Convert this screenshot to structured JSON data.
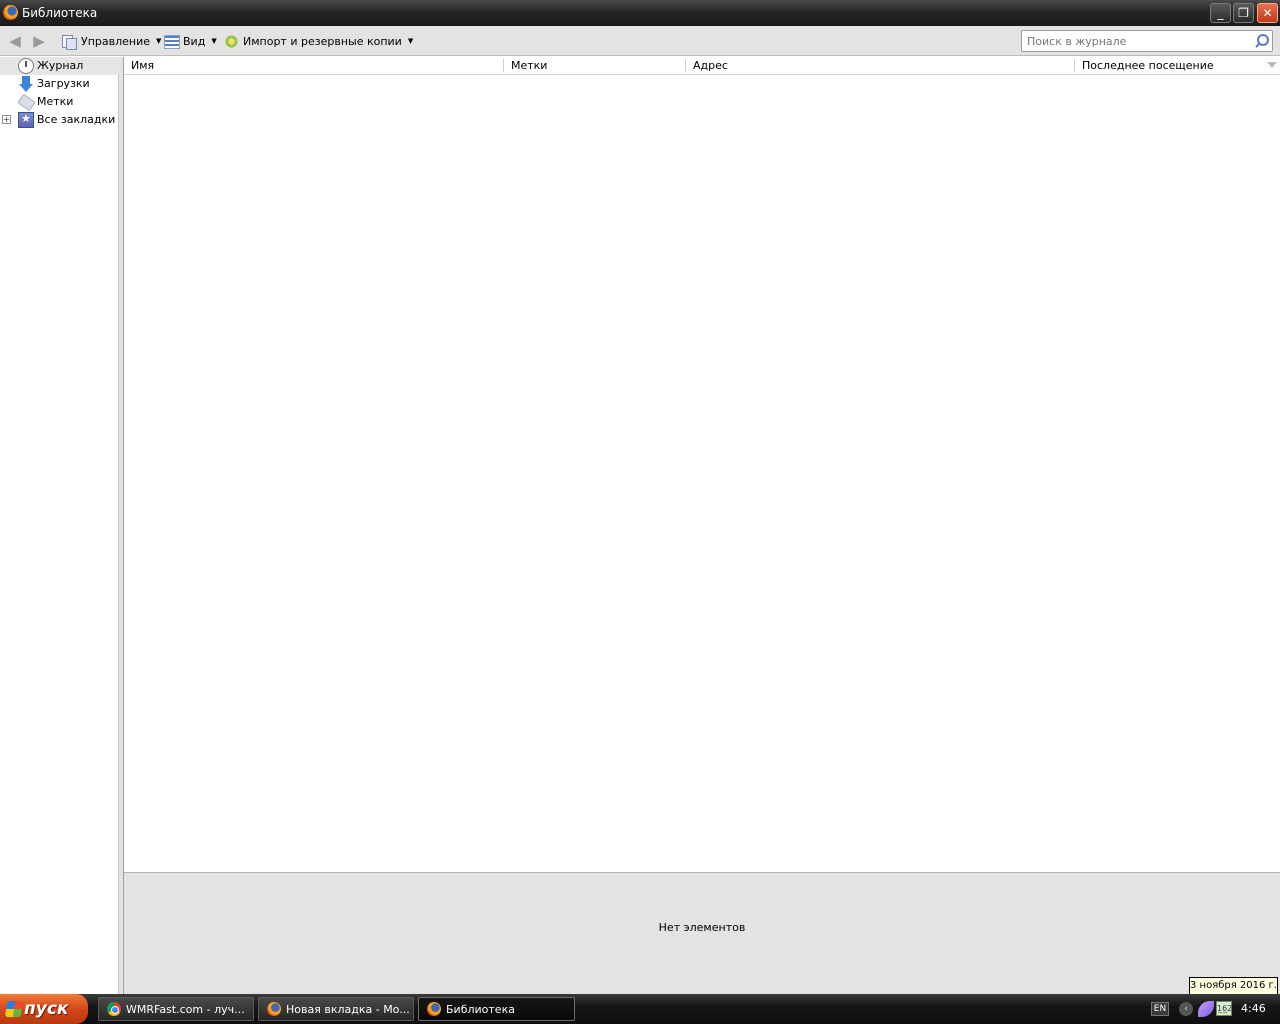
{
  "window": {
    "title": "Библиотека",
    "controls": {
      "minimize": "_",
      "restore": "❐",
      "close": "✕"
    }
  },
  "toolbar": {
    "back_icon": "back-arrow-icon",
    "forward_icon": "forward-arrow-icon",
    "organize_label": "Управление",
    "views_label": "Вид",
    "import_label": "Импорт и резервные копии",
    "search_placeholder": "Поиск в журнале"
  },
  "sidebar": {
    "items": [
      {
        "label": "Журнал",
        "icon": "clock-icon",
        "selected": true
      },
      {
        "label": "Загрузки",
        "icon": "download-icon"
      },
      {
        "label": "Метки",
        "icon": "tag-icon"
      },
      {
        "label": "Все закладки",
        "icon": "bookmarks-icon",
        "expandable": true,
        "expander": "+"
      }
    ]
  },
  "list": {
    "columns": [
      "Имя",
      "Метки",
      "Адрес",
      "Последнее посещение"
    ],
    "rows": []
  },
  "details": {
    "empty_text": "Нет элементов"
  },
  "taskbar": {
    "start_label": "пуск",
    "tasks": [
      {
        "label": "WMRFast.com - луч...",
        "icon": "chrome-icon"
      },
      {
        "label": "Новая вкладка - Mo...",
        "icon": "firefox-icon"
      },
      {
        "label": "Библиотека",
        "icon": "firefox-icon",
        "active": true
      }
    ],
    "tray": {
      "language": "EN",
      "monitor_text": "1̲6̲2",
      "time": "4:46",
      "date_tooltip": "3 ноября 2016 г."
    }
  },
  "colors": {
    "toolbar_bg": "#e3e3e3",
    "titlebar_bg": "#262626",
    "start_orange": "#d4481a"
  }
}
